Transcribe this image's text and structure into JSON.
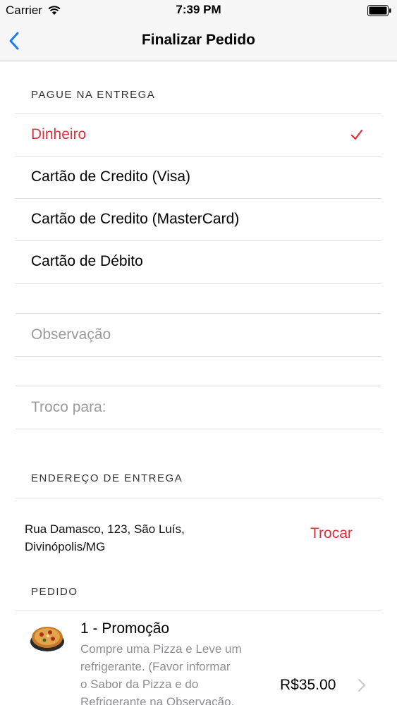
{
  "status_bar": {
    "carrier": "Carrier",
    "time": "7:39 PM"
  },
  "nav": {
    "title": "Finalizar Pedido",
    "back_icon": "chevron-left-icon"
  },
  "payment": {
    "header": "PAGUE NA ENTREGA",
    "options": [
      {
        "label": "Dinheiro",
        "selected": true
      },
      {
        "label": "Cartão de Credito (Visa)",
        "selected": false
      },
      {
        "label": "Cartão de Credito (MasterCard)",
        "selected": false
      },
      {
        "label": "Cartão de Débito",
        "selected": false
      }
    ]
  },
  "notes": {
    "observacao_placeholder": "Observação",
    "troco_placeholder": "Troco para:"
  },
  "delivery": {
    "header": "ENDEREÇO DE ENTREGA",
    "address_line1": "Rua Damasco, 123, São Luís,",
    "address_line2": "Divinópolis/MG",
    "change_label": "Trocar"
  },
  "order": {
    "header": "PEDIDO",
    "items": [
      {
        "title": "1 - Promoção",
        "description_lines": [
          "Compre uma Pizza e Leve um",
          "refrigerante. (Favor informar",
          "o Sabor da Pizza e do",
          "Refrigerante na Observação."
        ],
        "price": "R$35.00"
      }
    ]
  },
  "colors": {
    "accent": "#e0303e",
    "ios_blue": "#1a7cf5",
    "placeholder": "#9b9b9b"
  }
}
